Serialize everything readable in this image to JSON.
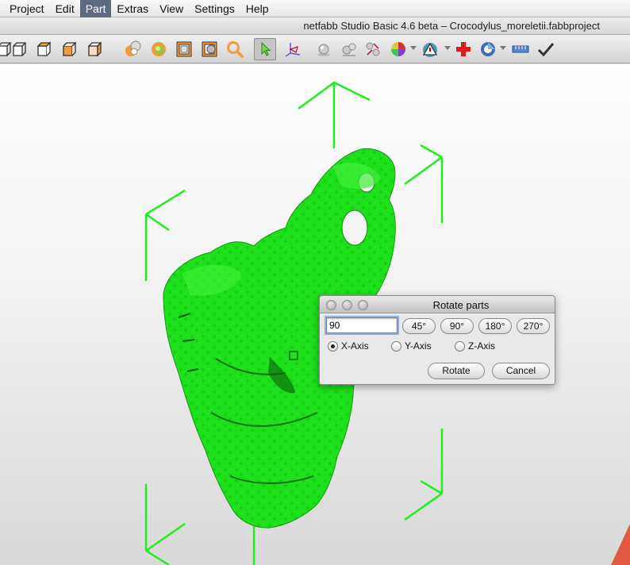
{
  "menubar": {
    "items": [
      "Project",
      "Edit",
      "Part",
      "Extras",
      "View",
      "Settings",
      "Help"
    ],
    "active": "Part"
  },
  "window": {
    "title": "netfabb Studio Basic 4.6 beta – Crocodylus_moreletii.fabbproject"
  },
  "toolbar": {
    "tools": [
      "view-front-icon",
      "view-back-icon",
      "view-top-icon",
      "view-side-icon",
      "shaded-view-icon",
      "sphere-view-icon",
      "box-view-icon",
      "section-view-icon",
      "zoom-icon",
      "select-arrow-icon",
      "axes-icon",
      "ball-icon",
      "balls-icon",
      "move-parts-icon",
      "color-wheel-icon",
      "warning-icon",
      "repair-cross-icon",
      "analysis-icon",
      "measure-icon",
      "checkmark-icon"
    ],
    "selected": "select-arrow-icon"
  },
  "colors": {
    "model": "#1ee01a",
    "bbox": "#1ef01a",
    "menu_active": "#5d6a80"
  },
  "dialog": {
    "title": "Rotate parts",
    "angle_value": "90",
    "presets": [
      "45°",
      "90°",
      "180°",
      "270°"
    ],
    "axes": [
      "X-Axis",
      "Y-Axis",
      "Z-Axis"
    ],
    "selected_axis": "X-Axis",
    "rotate_label": "Rotate",
    "cancel_label": "Cancel"
  }
}
